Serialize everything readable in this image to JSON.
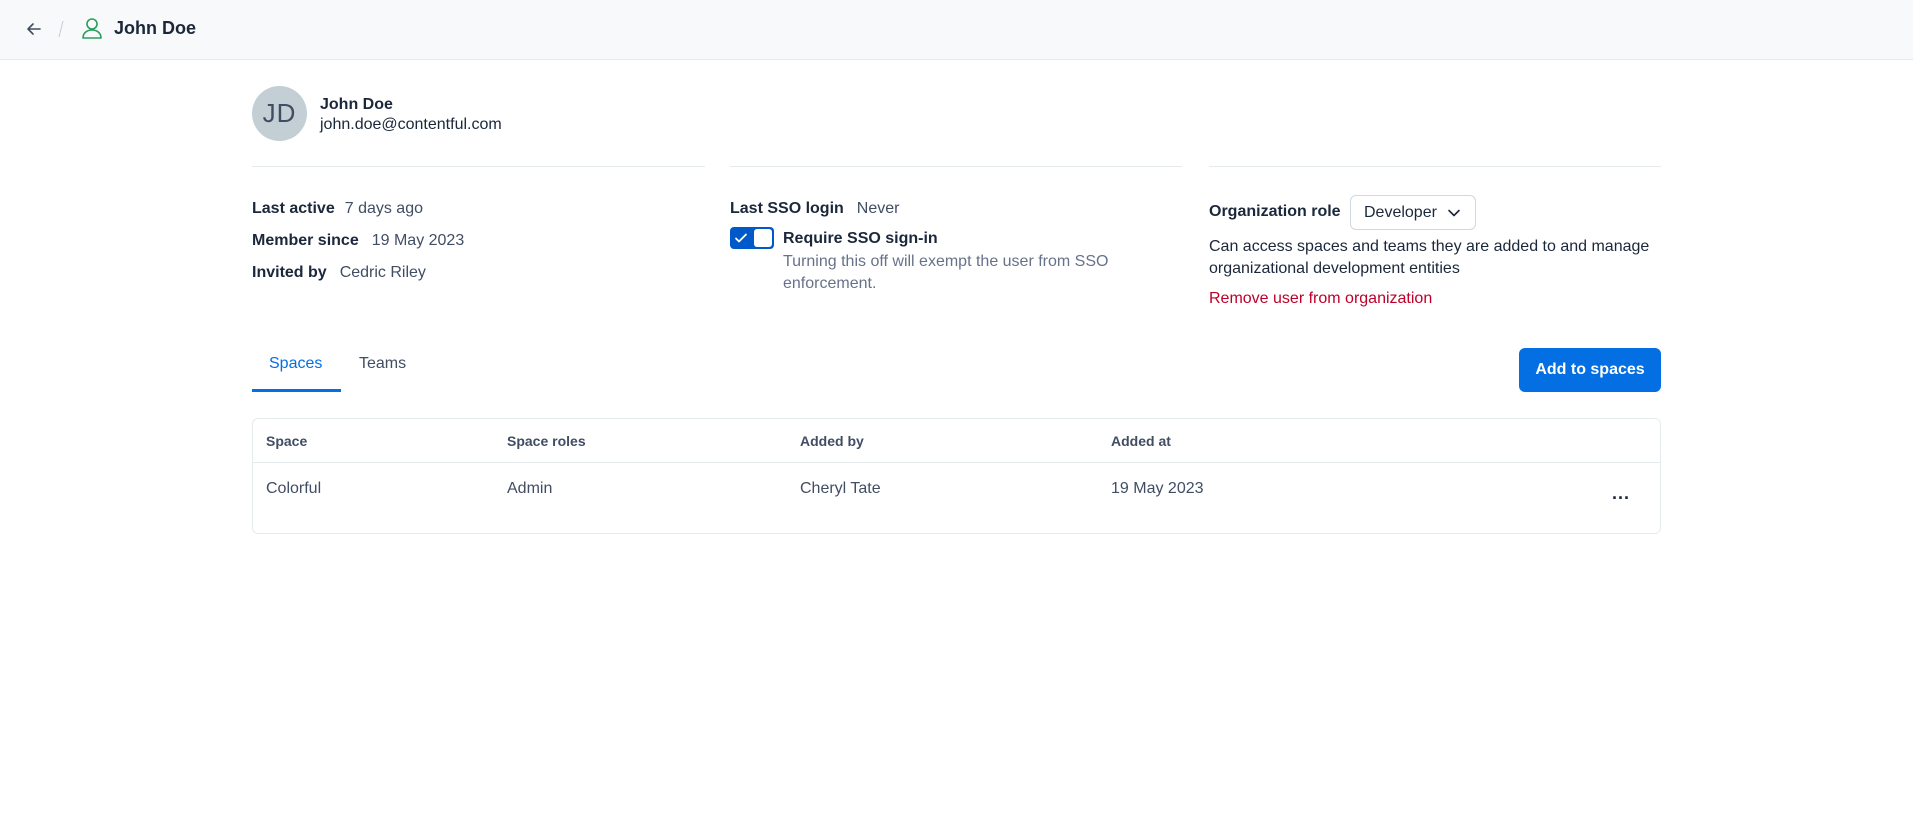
{
  "header": {
    "title": "John Doe",
    "back_icon": "arrow-left-icon",
    "user_icon": "user-icon",
    "accent_color": "#2a9d5c"
  },
  "profile": {
    "initials": "JD",
    "name": "John Doe",
    "email": "john.doe@contentful.com"
  },
  "details": {
    "last_active_label": "Last active",
    "last_active_value": "7 days ago",
    "member_since_label": "Member since",
    "member_since_value": "19 May 2023",
    "invited_by_label": "Invited by",
    "invited_by_value": "Cedric Riley"
  },
  "sso": {
    "last_login_label": "Last SSO login",
    "last_login_value": "Never",
    "require_label": "Require SSO sign-in",
    "require_enabled": true,
    "help_text": "Turning this off will exempt the user from SSO enforcement."
  },
  "organization_role": {
    "label": "Organization role",
    "selected": "Developer",
    "description": "Can access spaces and teams they are added to and manage organizational development entities",
    "remove_link": "Remove user from organization"
  },
  "tabs": [
    {
      "label": "Spaces",
      "active": true
    },
    {
      "label": "Teams",
      "active": false
    }
  ],
  "add_button_label": "Add to spaces",
  "table": {
    "columns": [
      "Space",
      "Space roles",
      "Added by",
      "Added at"
    ],
    "rows": [
      {
        "space": "Colorful",
        "role": "Admin",
        "added_by": "Cheryl Tate",
        "added_at": "19 May 2023",
        "actions": "..."
      }
    ]
  },
  "colors": {
    "primary": "#036fe3",
    "danger": "#bd002a",
    "toggle": "#0059c8"
  }
}
